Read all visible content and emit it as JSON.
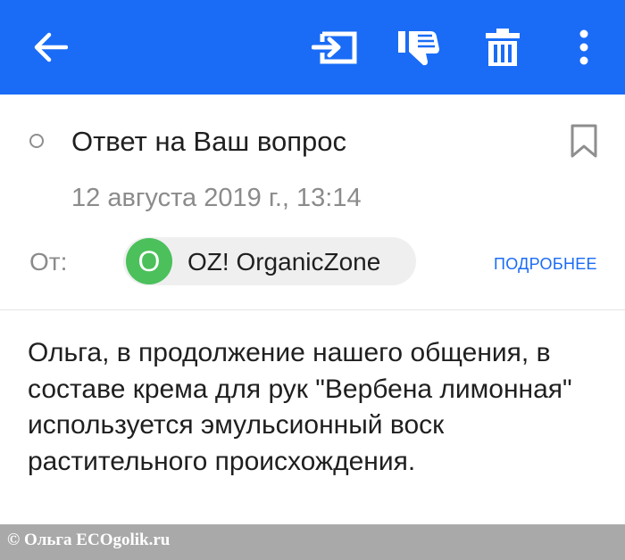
{
  "toolbar": {
    "background_color": "#1a6cf6",
    "icons": {
      "back": "arrow-left-icon",
      "move": "move-to-folder-icon",
      "spam": "thumbs-down-icon",
      "delete": "trash-icon",
      "more": "more-vertical-icon"
    }
  },
  "message": {
    "subject": "Ответ на Ваш вопрос",
    "date": "12 августа 2019 г., 13:14",
    "from_label": "От:",
    "sender": {
      "avatar_letter": "O",
      "avatar_color": "#4bc05b",
      "name": "OZ! OrganicZone"
    },
    "details_link": "ПОДРОБНЕЕ",
    "body": "Ольга, в продолжение нашего общения, в составе крема для рук \"Вербена лимонная\" используется эмульсионный воск растительного происхождения."
  },
  "watermark": {
    "text": "© Ольга ECOgolik.ru"
  }
}
